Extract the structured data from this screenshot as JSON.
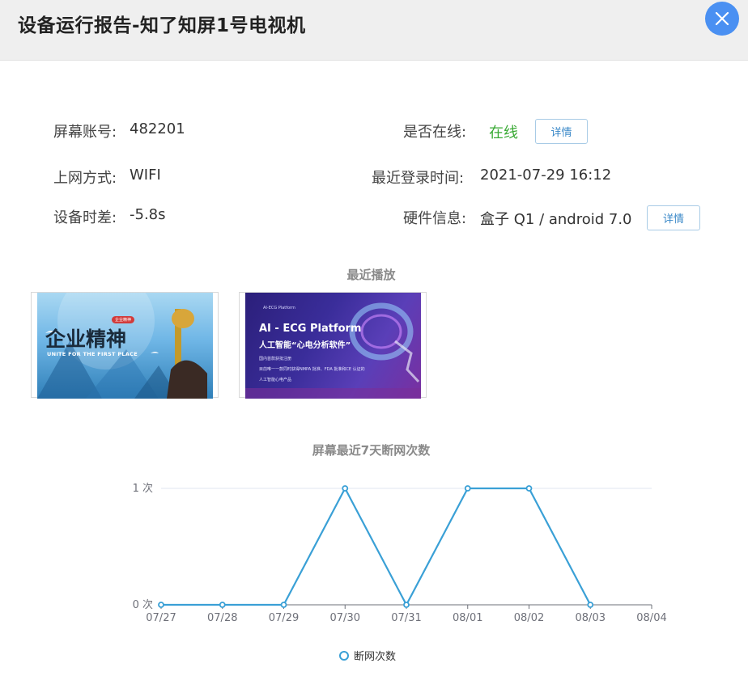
{
  "header": {
    "title": "设备运行报告-知了知屏1号电视机"
  },
  "info": {
    "account_label": "屏幕账号:",
    "account_value": "482201",
    "online_label": "是否在线:",
    "online_value": "在线",
    "network_label": "上网方式:",
    "network_value": "WIFI",
    "last_login_label": "最近登录时间:",
    "last_login_value": "2021-07-29 16:12",
    "time_diff_label": "设备时差:",
    "time_diff_value": "-5.8s",
    "hardware_label": "硬件信息:",
    "hardware_value": "盒子 Q1 / android 7.0",
    "detail_label": "详情"
  },
  "recent": {
    "title": "最近播放",
    "items": [
      {
        "title": "企业精神",
        "subtitle": "UNITE FOR THE FIRST PLACE",
        "badge": "企业精神"
      },
      {
        "brand": "AI-ECG Platform",
        "title": "AI - ECG Platform",
        "subtitle": "人工智能“心电分析软件”",
        "line1": "国内首款获批注册",
        "line2": "目前唯一一款同时获得NMPA 批准、FDA 批准和CE 认证的",
        "line3": "人工智能心电产品"
      }
    ]
  },
  "colors": {
    "accent": "#4a90f2",
    "online": "#3aaa35",
    "series": "#3aa0d6"
  },
  "chart_data": {
    "type": "line",
    "title": "屏幕最近7天断网次数",
    "x": [
      "07/27",
      "07/28",
      "07/29",
      "07/30",
      "07/31",
      "08/01",
      "08/02",
      "08/03",
      "08/04"
    ],
    "series": [
      {
        "name": "断网次数",
        "values": [
          0,
          0,
          0,
          1,
          0,
          1,
          1,
          0
        ]
      }
    ],
    "yticks": [
      "0 次",
      "1 次"
    ],
    "ylim": [
      0,
      1
    ],
    "grid": true,
    "legend": "bottom"
  }
}
